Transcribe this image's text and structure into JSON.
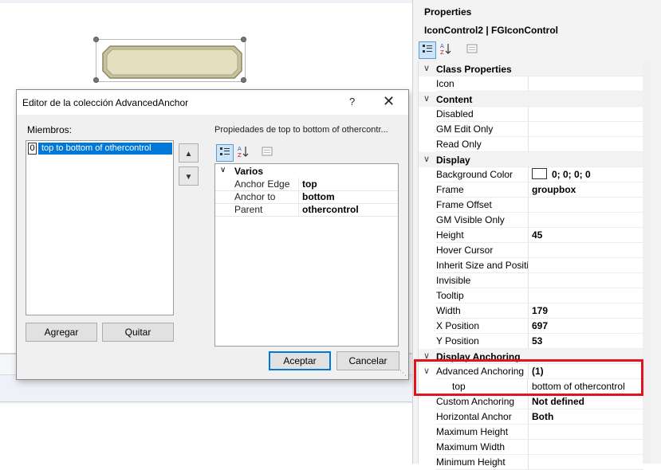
{
  "dialog": {
    "title": "Editor de la colección AdvancedAnchor",
    "help_glyph": "?",
    "close_glyph": "✕",
    "members_label": "Miembros:",
    "properties_label": "Propiedades de top to bottom of othercontr...",
    "members": [
      {
        "index": "0",
        "text": "top to bottom of othercontrol"
      }
    ],
    "move_up_glyph": "▲",
    "move_down_glyph": "▼",
    "add_label": "Agregar",
    "remove_label": "Quitar",
    "accept_label": "Aceptar",
    "cancel_label": "Cancelar",
    "grid": {
      "category": "Varios",
      "rows": [
        {
          "name": "Anchor Edge",
          "value": "top"
        },
        {
          "name": "Anchor to",
          "value": "bottom"
        },
        {
          "name": "Parent",
          "value": "othercontrol"
        }
      ]
    },
    "toolbar_icons": [
      "categorized-icon",
      "alphabetical-icon",
      "property-pages-icon"
    ]
  },
  "properties": {
    "title": "Properties",
    "object": "IconControl2 | FGIconControl",
    "rows": [
      {
        "type": "cat",
        "label": "Class Properties"
      },
      {
        "type": "prop",
        "name": "Icon",
        "value": ""
      },
      {
        "type": "cat",
        "label": "Content"
      },
      {
        "type": "prop",
        "name": "Disabled",
        "value": ""
      },
      {
        "type": "prop",
        "name": "GM Edit Only",
        "value": ""
      },
      {
        "type": "prop",
        "name": "Read Only",
        "value": ""
      },
      {
        "type": "cat",
        "label": "Display"
      },
      {
        "type": "prop",
        "name": "Background Color",
        "value": "0; 0; 0; 0",
        "swatch": true
      },
      {
        "type": "prop",
        "name": "Frame",
        "value": "groupbox"
      },
      {
        "type": "prop",
        "name": "Frame Offset",
        "value": ""
      },
      {
        "type": "prop",
        "name": "GM Visible Only",
        "value": ""
      },
      {
        "type": "prop",
        "name": "Height",
        "value": "45"
      },
      {
        "type": "prop",
        "name": "Hover Cursor",
        "value": ""
      },
      {
        "type": "prop",
        "name": "Inherit Size and Positio",
        "value": ""
      },
      {
        "type": "prop",
        "name": "Invisible",
        "value": ""
      },
      {
        "type": "prop",
        "name": "Tooltip",
        "value": ""
      },
      {
        "type": "prop",
        "name": "Width",
        "value": "179"
      },
      {
        "type": "prop",
        "name": "X Position",
        "value": "697"
      },
      {
        "type": "prop",
        "name": "Y Position",
        "value": "53"
      },
      {
        "type": "cat",
        "label": "Display Anchoring"
      },
      {
        "type": "prop",
        "name": "Advanced Anchoring",
        "value": "(1)",
        "expanded": true
      },
      {
        "type": "sub",
        "name": "top",
        "value": "bottom of othercontrol"
      },
      {
        "type": "prop",
        "name": "Custom Anchoring",
        "value": "Not defined"
      },
      {
        "type": "prop",
        "name": "Horizontal Anchor",
        "value": "Both"
      },
      {
        "type": "prop",
        "name": "Maximum Height",
        "value": ""
      },
      {
        "type": "prop",
        "name": "Maximum Width",
        "value": ""
      },
      {
        "type": "prop",
        "name": "Minimum Height",
        "value": ""
      }
    ]
  },
  "colors": {
    "selection": "#0078d7",
    "highlight_box": "#e0141e",
    "control_fill": "#e8e4c4"
  }
}
